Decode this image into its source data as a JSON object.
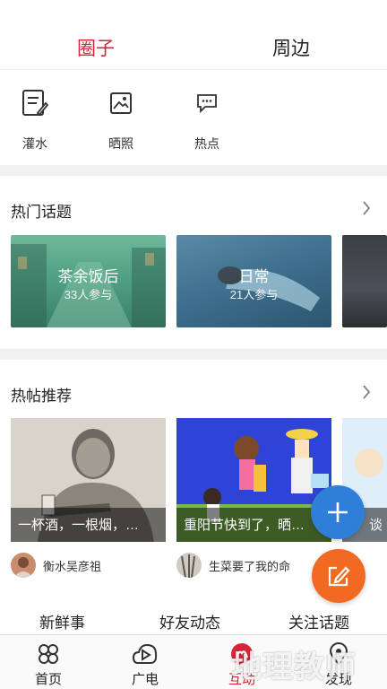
{
  "top_tabs": {
    "circle": "圈子",
    "nearby": "周边"
  },
  "quick_actions": [
    {
      "label": "灌水",
      "icon": "note-edit-icon"
    },
    {
      "label": "晒照",
      "icon": "photo-icon"
    },
    {
      "label": "热点",
      "icon": "chat-bubble-icon"
    }
  ],
  "hot_topics": {
    "title": "热门话题",
    "items": [
      {
        "name": "茶余饭后",
        "count": "33人参与"
      },
      {
        "name": "日常",
        "count": "21人参与"
      }
    ]
  },
  "hot_posts": {
    "title": "热帖推荐",
    "items": [
      {
        "caption": "一杯酒，一根烟，…",
        "author": "衡水吴彦祖"
      },
      {
        "caption": "重阳节快到了，晒…",
        "author": "生菜要了我的命"
      },
      {
        "caption": "谈",
        "author": ""
      }
    ]
  },
  "sub_tabs": [
    "新鲜事",
    "好友动态",
    "关注话题"
  ],
  "bottom_nav": [
    {
      "label": "首页",
      "icon": "home-flower-icon"
    },
    {
      "label": "广电",
      "icon": "play-cloud-icon"
    },
    {
      "label": "互动",
      "icon": "interact-icon"
    },
    {
      "label": "发现",
      "icon": "location-pin-icon"
    }
  ],
  "watermark": "地理教师",
  "colors": {
    "accent": "#d6253a",
    "fab_blue": "#2f7fd8",
    "fab_orange": "#f26a21"
  }
}
